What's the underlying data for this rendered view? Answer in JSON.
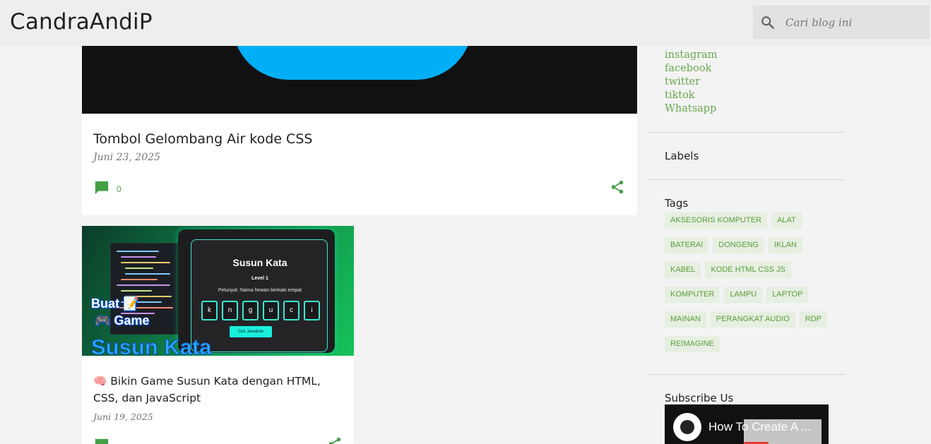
{
  "header": {
    "site_title": "CandraAndiP",
    "search_placeholder": "Cari blog ini"
  },
  "posts": [
    {
      "title": "Tombol Gelombang Air kode CSS",
      "date": "Juni 23, 2025",
      "comments": "0"
    },
    {
      "title_emoji": "🧠",
      "title": "Bikin Game Susun Kata dengan HTML, CSS, dan JavaScript",
      "date": "Juni 19, 2025",
      "thumbnail": {
        "game_title": "Susun Kata",
        "level": "Level 1",
        "hint": "Petunjuk: Nama hewan berkaki empat",
        "letters": [
          "k",
          "n",
          "g",
          "u",
          "c",
          "i"
        ],
        "button": "Cek Jawaban",
        "caption_line1": "Buat 📝",
        "caption_line2": "🎮 Game",
        "caption_line3": "Susun Kata"
      }
    }
  ],
  "sidebar": {
    "social_links": [
      "instagram",
      "facebook",
      "twitter",
      "tiktok",
      "Whatsapp"
    ],
    "labels_heading": "Labels",
    "tags_heading": "Tags",
    "tags": [
      "AKSESORIS KOMPUTER",
      "ALAT",
      "BATERAI",
      "DONGENG",
      "IKLAN",
      "KABEL",
      "KODE HTML CSS JS",
      "KOMPUTER",
      "LAMPU",
      "LAPTOP",
      "MAINAN",
      "PERANGKAT AUDIO",
      "RDP",
      "REIMAGINE"
    ],
    "subscribe_heading": "Subscribe Us",
    "video_title": "How To Create A ..."
  },
  "colors": {
    "accent_green": "#6aa84f",
    "icon_green": "#43a047",
    "button_blue": "#00aff5"
  }
}
